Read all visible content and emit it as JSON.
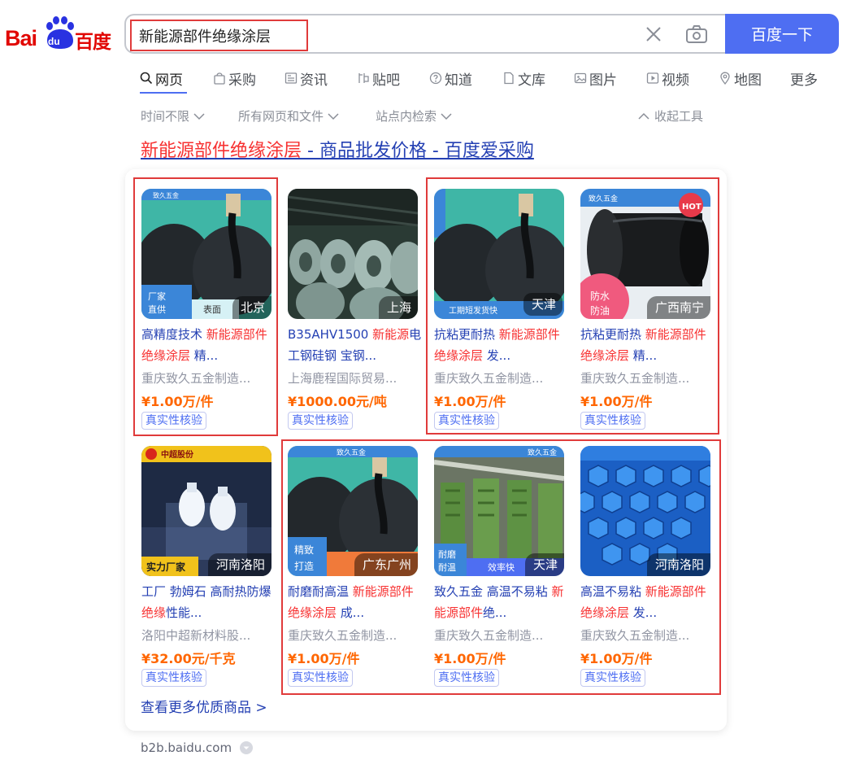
{
  "logo": {
    "latin_bai": "Bai",
    "latin_du": "du",
    "chinese": "百度"
  },
  "search": {
    "query": "新能源部件绝缘涂层",
    "button_label": "百度一下"
  },
  "tabs": [
    {
      "label": "网页",
      "icon": "search-icon",
      "active": true
    },
    {
      "label": "采购",
      "icon": "shopping-bag-icon"
    },
    {
      "label": "资讯",
      "icon": "news-icon"
    },
    {
      "label": "贴吧",
      "icon": "tieba-icon"
    },
    {
      "label": "知道",
      "icon": "question-icon"
    },
    {
      "label": "文库",
      "icon": "document-icon"
    },
    {
      "label": "图片",
      "icon": "image-icon"
    },
    {
      "label": "视频",
      "icon": "video-icon"
    },
    {
      "label": "地图",
      "icon": "map-pin-icon"
    },
    {
      "label": "更多"
    }
  ],
  "filters": {
    "time": "时间不限",
    "file_type": "所有网页和文件",
    "site_search": "站点内检索",
    "collapse": "收起工具"
  },
  "result": {
    "title_em": "新能源部件绝缘涂层",
    "title_rest": " - 商品批发价格 - 百度爱采购",
    "more_link": "查看更多优质商品 >",
    "source": "b2b.baidu.com"
  },
  "products": [
    {
      "location": "北京",
      "title_pre": "高精度技术 ",
      "title_em": "新能源部件绝缘涂层",
      "title_post": " 精...",
      "seller": "重庆致久五金制造...",
      "price": "¥1.00万/件",
      "badge": "真实性核验",
      "image": "teapot"
    },
    {
      "location": "上海",
      "title_pre": "B35AHV1500 ",
      "title_em": "新能源",
      "title_post": "电工钢硅钢 宝钢...",
      "seller": "上海鹿程国际贸易...",
      "price": "¥1000.00元/吨",
      "badge": "真实性核验",
      "image": "steel-coils"
    },
    {
      "location": "天津",
      "title_pre": "抗粘更耐热 ",
      "title_em": "新能源部件绝缘涂层",
      "title_post": " 发...",
      "seller": "重庆致久五金制造...",
      "price": "¥1.00万/件",
      "badge": "真实性核验",
      "image": "teapot"
    },
    {
      "location": "广西南宁",
      "title_pre": "抗粘更耐热 ",
      "title_em": "新能源部件绝缘涂层",
      "title_post": " 精...",
      "seller": "重庆致久五金制造...",
      "price": "¥1.00万/件",
      "badge": "真实性核验",
      "image": "black-pipe"
    },
    {
      "location": "河南洛阳",
      "title_pre": "工厂 勃姆石 高耐热防爆 ",
      "title_em": "绝缘",
      "title_post": "性能...",
      "seller": "洛阳中超新材料股...",
      "price": "¥32.00元/千克",
      "badge": "真实性核验",
      "image": "powder-bottles"
    },
    {
      "location": "广东广州",
      "title_pre": "耐磨耐高温 ",
      "title_em": "新能源部件绝缘涂层",
      "title_post": " 成...",
      "seller": "重庆致久五金制造...",
      "price": "¥1.00万/件",
      "badge": "真实性核验",
      "image": "teapot"
    },
    {
      "location": "天津",
      "title_pre": "致久五金 高温不易粘 ",
      "title_em": "新能源部件",
      "title_post": "绝...",
      "seller": "重庆致久五金制造...",
      "price": "¥1.00万/件",
      "badge": "真实性核验",
      "image": "green-panels"
    },
    {
      "location": "河南洛阳",
      "title_pre": "高温不易粘 ",
      "title_em": "新能源部件绝缘涂层",
      "title_post": " 发...",
      "seller": "重庆致久五金制造...",
      "price": "¥1.00万/件",
      "badge": "真实性核验",
      "image": "blue-bolts"
    }
  ],
  "image_overlays": {
    "brand_strip": "致久五金",
    "factory_direct": "厂家直供",
    "surface": "表面",
    "fast_delivery": "工期短发货快",
    "hot": "HOT",
    "waterproof": "防水防油",
    "strong_factory": "实力厂家",
    "fine_craft": "精致打造",
    "wear_resist": "耐磨耐温",
    "efficiency": "效率快",
    "supplier_logo": "中超股份"
  }
}
